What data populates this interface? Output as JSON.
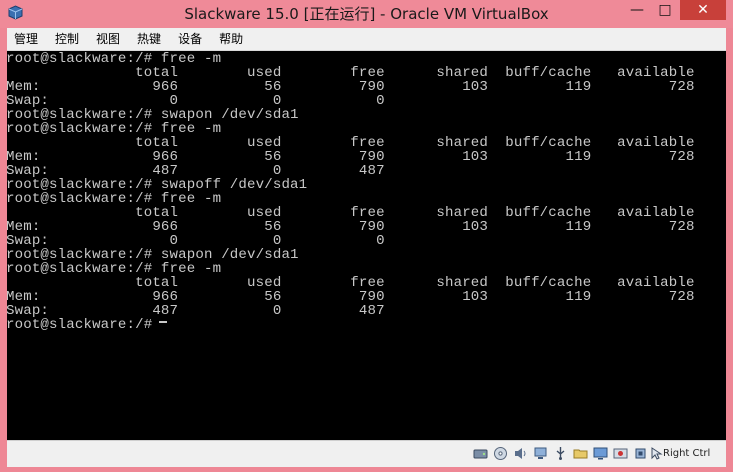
{
  "window": {
    "title": "Slackware 15.0 [正在运行] - Oracle VM VirtualBox",
    "minimize_glyph": "—",
    "maximize_glyph": "□",
    "close_glyph": "✕"
  },
  "menubar": {
    "items": [
      "管理",
      "控制",
      "视图",
      "热键",
      "设备",
      "帮助"
    ]
  },
  "terminal": {
    "prompt": "root@slackware:/#",
    "lines": [
      "root@slackware:/# free -m",
      "               total        used        free      shared  buff/cache   available",
      "Mem:             966          56         790         103         119         728",
      "Swap:              0           0           0",
      "root@slackware:/# swapon /dev/sda1",
      "root@slackware:/# free -m",
      "               total        used        free      shared  buff/cache   available",
      "Mem:             966          56         790         103         119         728",
      "Swap:            487           0         487",
      "root@slackware:/# swapoff /dev/sda1",
      "root@slackware:/# free -m",
      "               total        used        free      shared  buff/cache   available",
      "Mem:             966          56         790         103         119         728",
      "Swap:              0           0           0",
      "root@slackware:/# swapon /dev/sda1",
      "root@slackware:/# free -m",
      "               total        used        free      shared  buff/cache   available",
      "Mem:             966          56         790         103         119         728",
      "Swap:            487           0         487",
      "root@slackware:/#"
    ]
  },
  "statusbar": {
    "host_key_label": "Right Ctrl",
    "icons": [
      "hard-disk-icon",
      "optical-drive-icon",
      "audio-icon",
      "network-icon",
      "usb-icon",
      "shared-folder-icon",
      "display-icon",
      "recording-icon",
      "guest-additions-icon",
      "cpu-icon",
      "mouse-integration-icon",
      "keyboard-icon"
    ]
  },
  "colors": {
    "titlebar": "#ef8a98",
    "close_button": "#c8403a",
    "terminal_bg": "#000000",
    "terminal_fg": "#c8c8c8"
  }
}
